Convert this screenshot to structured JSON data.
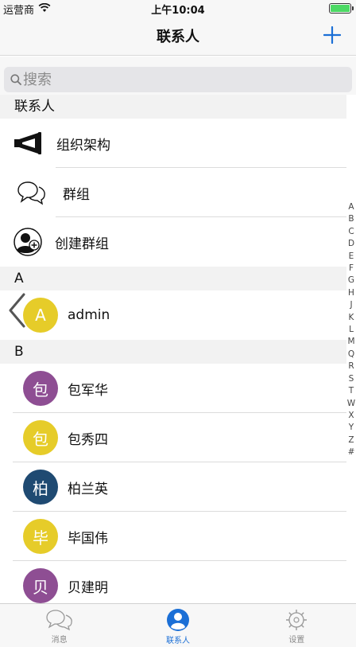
{
  "status_bar": {
    "carrier": "运营商",
    "time": "上午10:04"
  },
  "nav": {
    "title": "联系人",
    "add_icon": "plus-icon"
  },
  "search": {
    "placeholder": "搜索"
  },
  "sections": {
    "contacts_header": "联系人",
    "fixed_items": [
      {
        "label": "组织架构",
        "icon": "megaphone-icon"
      },
      {
        "label": "群组",
        "icon": "chat-bubbles-icon"
      },
      {
        "label": "创建群组",
        "icon": "add-group-icon"
      }
    ],
    "a_header": "A",
    "a_items": [
      {
        "initial": "A",
        "name": "admin",
        "color": "#e6cc29"
      }
    ],
    "b_header": "B",
    "b_items": [
      {
        "initial": "包",
        "name": "包军华",
        "color": "#8e4e93"
      },
      {
        "initial": "包",
        "name": "包秀四",
        "color": "#e6cc29"
      },
      {
        "initial": "柏",
        "name": "柏兰英",
        "color": "#1f4a72"
      },
      {
        "initial": "毕",
        "name": "毕国伟",
        "color": "#e6cc29"
      },
      {
        "initial": "贝",
        "name": "贝建明",
        "color": "#8e4e93"
      }
    ]
  },
  "index": [
    "A",
    "B",
    "C",
    "D",
    "E",
    "F",
    "G",
    "H",
    "J",
    "K",
    "L",
    "M",
    "Q",
    "R",
    "S",
    "T",
    "W",
    "X",
    "Y",
    "Z",
    "#"
  ],
  "tabs": [
    {
      "label": "消息",
      "icon": "chat-bubbles-icon",
      "active": false
    },
    {
      "label": "联系人",
      "icon": "person-icon",
      "active": true
    },
    {
      "label": "设置",
      "icon": "gear-icon",
      "active": false
    }
  ],
  "colors": {
    "accent": "#1b6fd6",
    "yellow": "#e6cc29",
    "purple": "#8e4e93",
    "navy": "#1f4a72"
  }
}
